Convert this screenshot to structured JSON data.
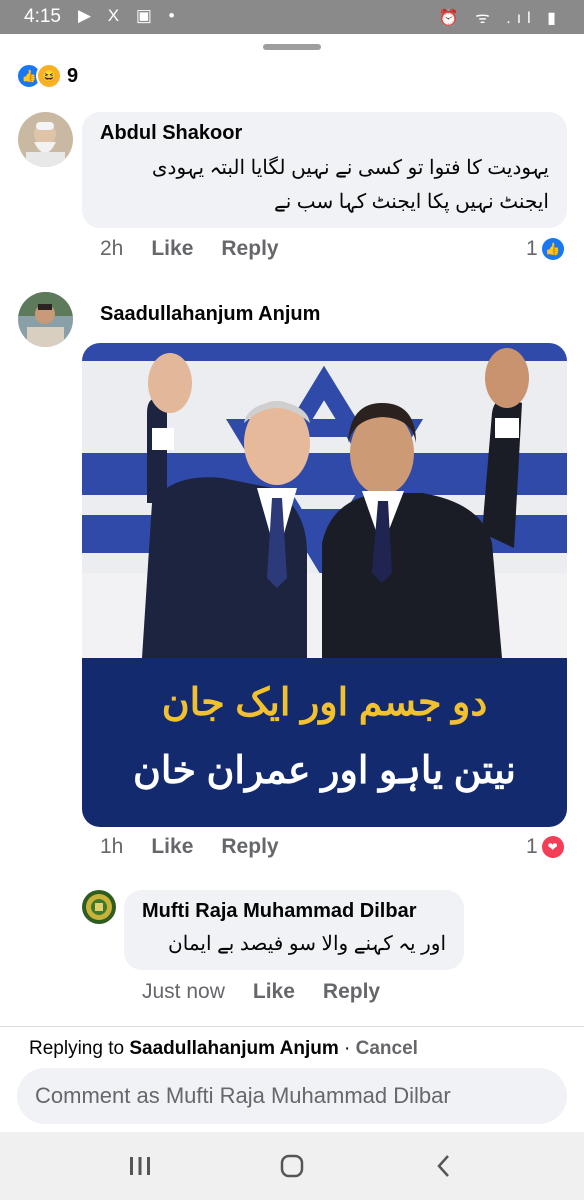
{
  "status_bar": {
    "time": "4:15",
    "left_icons": "▶ X ▣ •",
    "right_icons": "⏰ ᯤ .ıl ▮"
  },
  "post_reactions": {
    "count": "9"
  },
  "comments": [
    {
      "author": "Abdul Shakoor",
      "text_line1": "یہودیت کا فتوا  تو کسی نے نہیں لگایا  البتہ یہودی",
      "text_line2": "ایجنٹ نہیں پکا ایجنٹ کہا سب نے",
      "time": "2h",
      "like": "Like",
      "reply": "Reply",
      "reaction_count": "1"
    },
    {
      "author": "Saadullahanjum Anjum",
      "image_text_line1": "دو جسم اور ایک جان",
      "image_text_line2": "نیتن یاہو اور عمران خان",
      "time": "1h",
      "like": "Like",
      "reply": "Reply",
      "reaction_count": "1"
    }
  ],
  "reply": {
    "author": "Mufti Raja Muhammad Dilbar",
    "text": "اور یہ کہنے والا سو فیصد بے ایمان",
    "time": "Just now",
    "like": "Like",
    "reply": "Reply"
  },
  "composer": {
    "replying_prefix": "Replying to ",
    "replying_to": "Saadullahanjum Anjum",
    "separator": " · ",
    "cancel": "Cancel",
    "placeholder": "Comment as Mufti Raja Muhammad Dilbar"
  },
  "colors": {
    "accent_blue": "#1877f2",
    "love_red": "#f33e58",
    "bubble_gray": "#f0f2f5"
  }
}
